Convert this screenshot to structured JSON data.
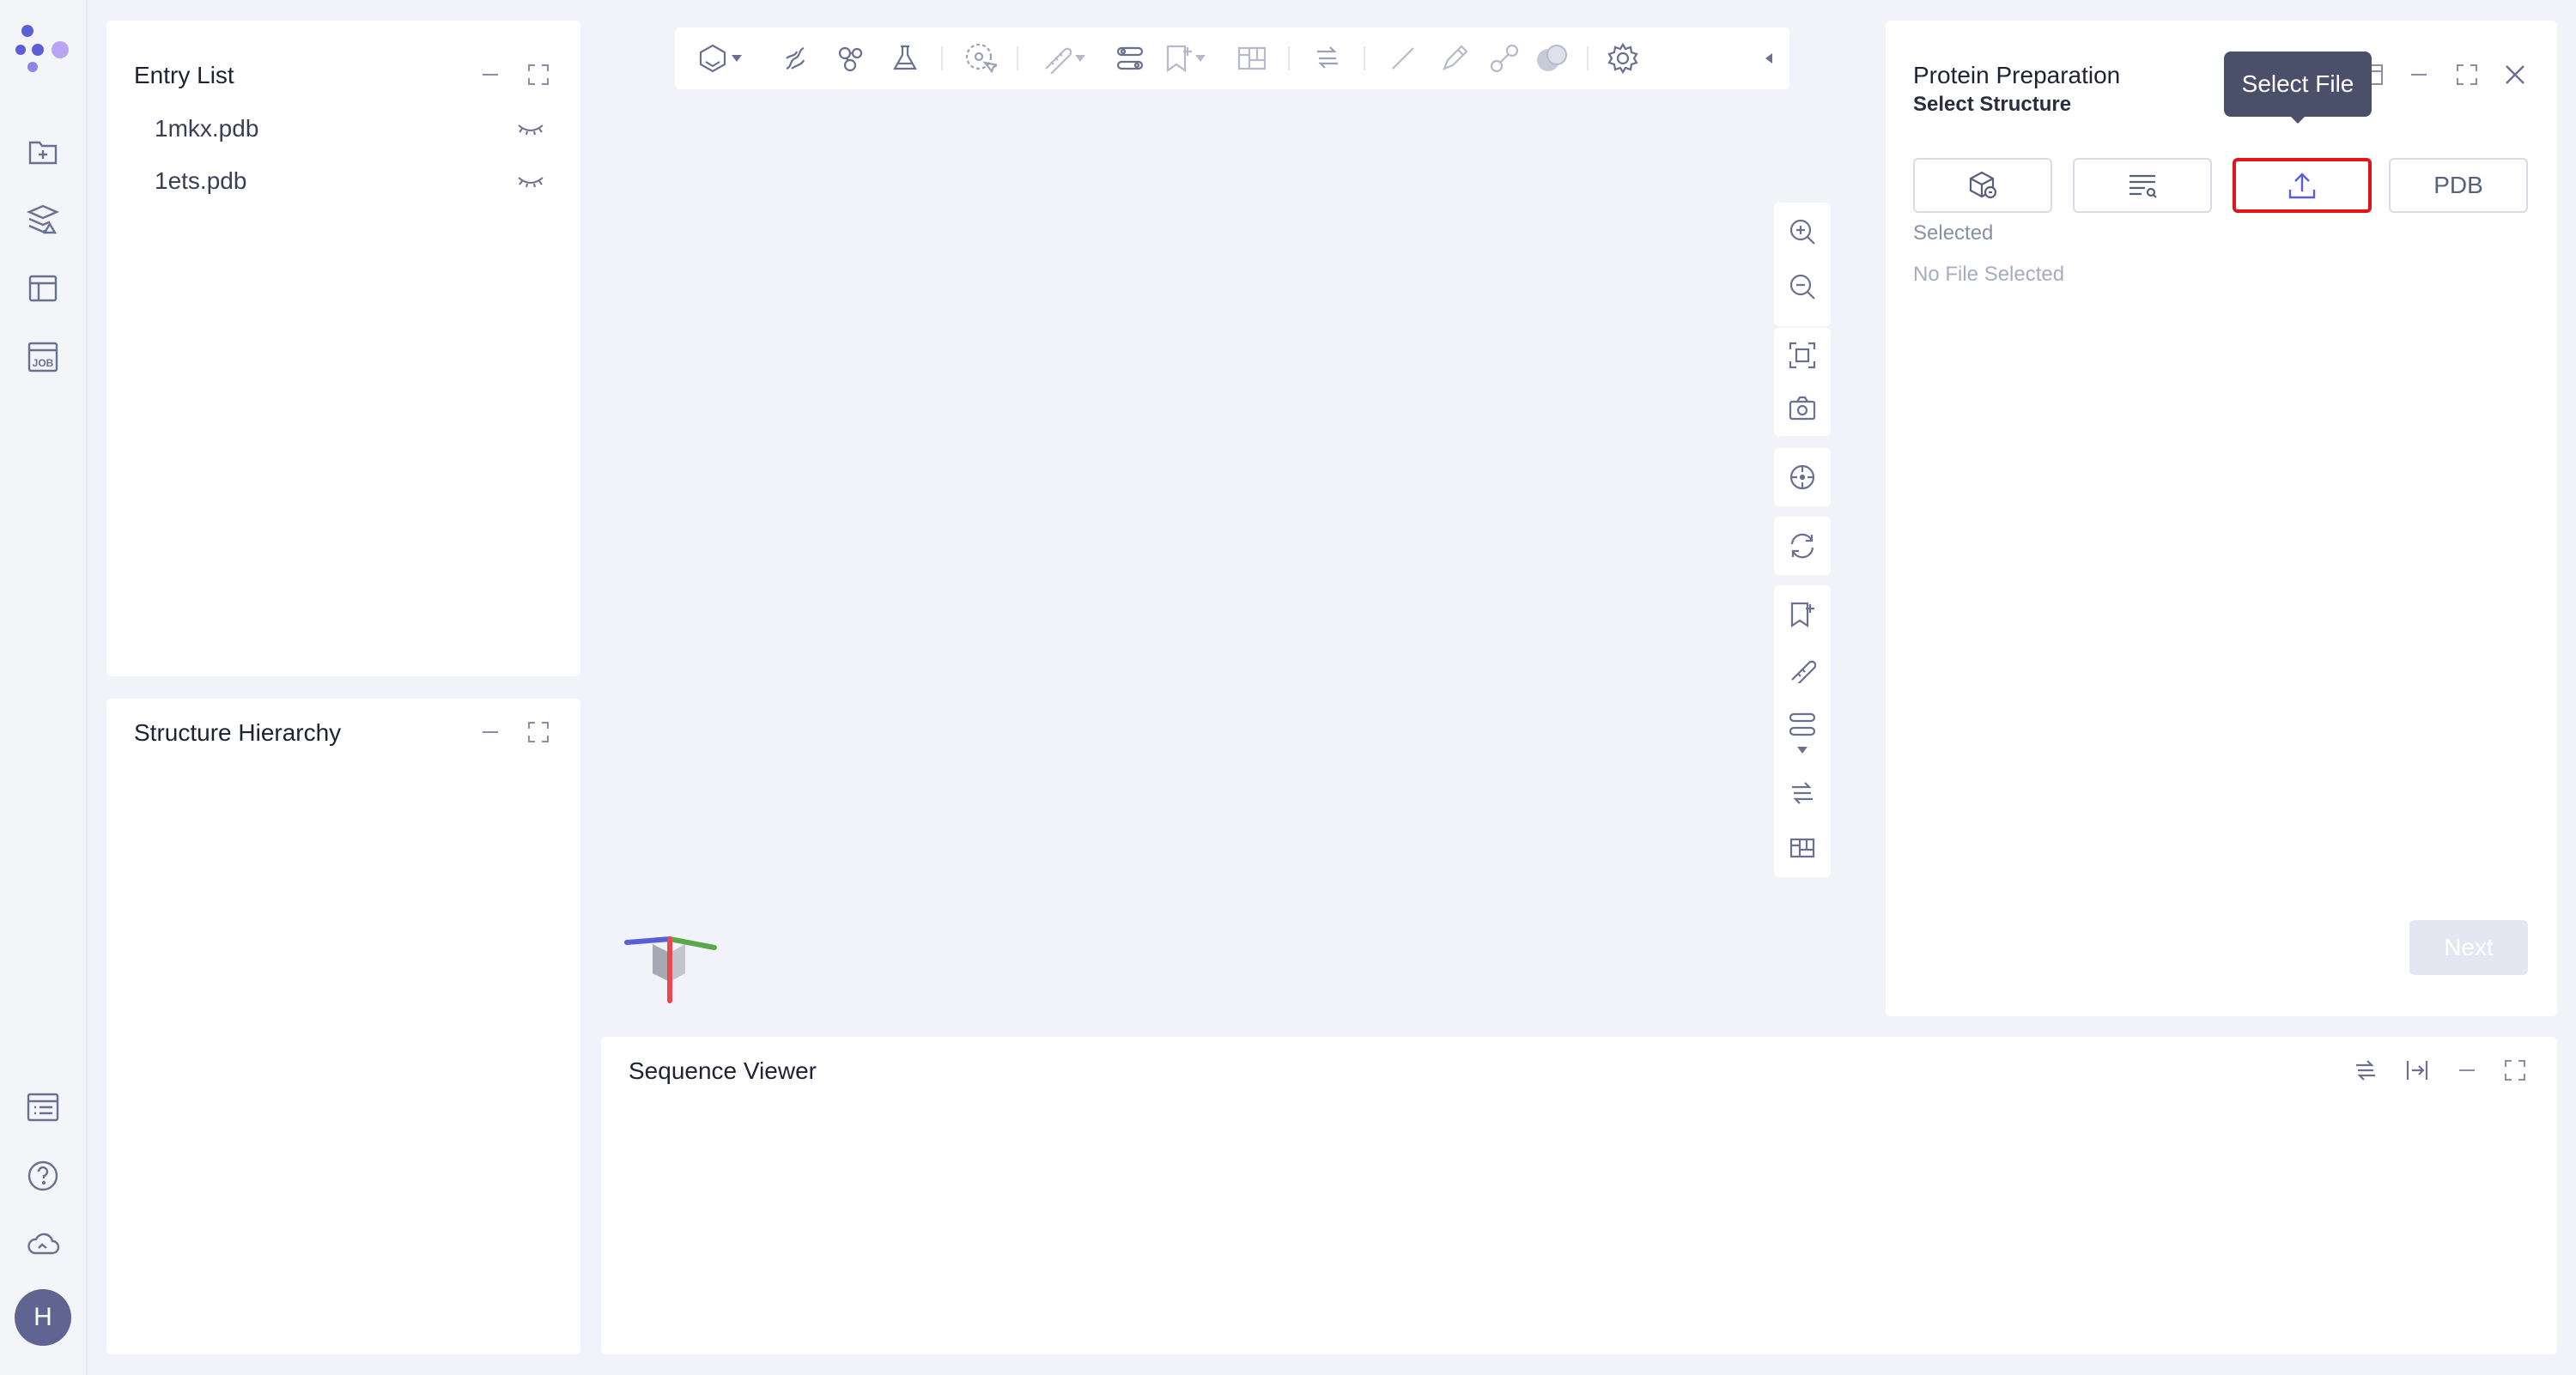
{
  "rail": {
    "items": [
      "new-project-icon",
      "layers-icon",
      "layout-icon",
      "job-icon"
    ],
    "bottom_items": [
      "list-icon",
      "help-icon",
      "cloud-icon"
    ],
    "avatar_letter": "H",
    "job_label": "JOB"
  },
  "entry_list": {
    "title": "Entry List",
    "entries": [
      {
        "name": "1mkx.pdb"
      },
      {
        "name": "1ets.pdb"
      }
    ]
  },
  "structure_hierarchy": {
    "title": "Structure Hierarchy"
  },
  "sequence_viewer": {
    "title": "Sequence Viewer"
  },
  "protein_preparation": {
    "title": "Protein Preparation",
    "section_label": "Select Structure",
    "buttons": [
      "workspace-structure-icon",
      "entry-list-icon",
      "upload-icon",
      "PDB"
    ],
    "pdb_label": "PDB",
    "selected_label": "Selected",
    "selected_value": "No File Selected",
    "next_label": "Next",
    "tooltip": "Select File"
  },
  "colors": {
    "accent": "#5b5fd6",
    "highlight_border": "#e0151b",
    "axis_x": "#e8484f",
    "axis_y": "#59a84b",
    "axis_z": "#5b5fd6"
  }
}
